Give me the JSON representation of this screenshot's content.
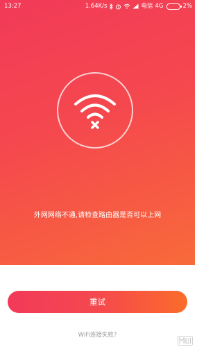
{
  "status_bar": {
    "time": "13:27",
    "speed": "1.64K/s",
    "carrier": "电信",
    "network": "4G",
    "battery": "2%"
  },
  "main": {
    "error_message": "外网网络不通,请检查路由器是否可以上网"
  },
  "actions": {
    "retry_label": "重试",
    "fail_link": "WiFi连接失败?"
  },
  "watermark": {
    "text": "MIUI"
  },
  "colors": {
    "gradient_start": "#f23a58",
    "gradient_end": "#f86a3a",
    "button_end": "#fb6c2a",
    "link_gray": "#9a9a9a"
  },
  "icons": {
    "center": "wifi-disconnected-icon",
    "status": [
      "bluetooth-icon",
      "alarm-icon",
      "wifi-icon",
      "signal-icon",
      "battery-icon"
    ]
  }
}
